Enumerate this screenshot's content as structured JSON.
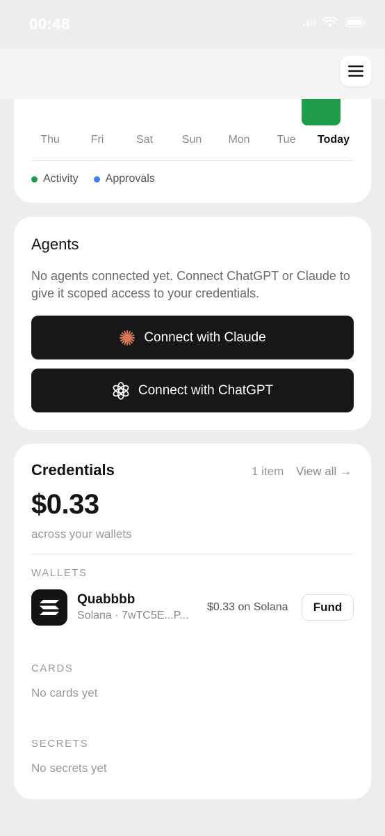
{
  "status_bar": {
    "time": "00:48"
  },
  "header": {
    "menu_icon": "hamburger-menu-icon"
  },
  "activity": {
    "days": [
      "Thu",
      "Fri",
      "Sat",
      "Sun",
      "Mon",
      "Tue",
      "Today"
    ],
    "legend": [
      {
        "label": "Activity",
        "color": "#1f9d4a"
      },
      {
        "label": "Approvals",
        "color": "#3b82f6"
      }
    ]
  },
  "agents": {
    "title": "Agents",
    "description": "No agents connected yet. Connect ChatGPT or Claude to give it scoped access to your credentials.",
    "connect_claude_label": "Connect with Claude",
    "connect_chatgpt_label": "Connect with ChatGPT",
    "claude_icon": "claude-logo-icon",
    "chatgpt_icon": "openai-logo-icon"
  },
  "credentials": {
    "title": "Credentials",
    "count": "1 item",
    "view_all": "View all →",
    "total": "$0.33",
    "subtitle": "across your wallets",
    "wallets_heading": "WALLETS",
    "wallet": {
      "name": "Quabbbb",
      "meta": "Solana · 7wTC5E...P...",
      "balance": "$0.33 on Solana",
      "fund_label": "Fund",
      "icon": "solana-logo-icon"
    },
    "cards_heading": "CARDS",
    "cards_empty": "No cards yet",
    "secrets_heading": "SECRETS",
    "secrets_empty": "No secrets yet"
  },
  "colors": {
    "accent_green": "#1f9d4a",
    "accent_blue": "#3b82f6",
    "button_dark": "#171717",
    "claude_orange": "#d97757"
  }
}
